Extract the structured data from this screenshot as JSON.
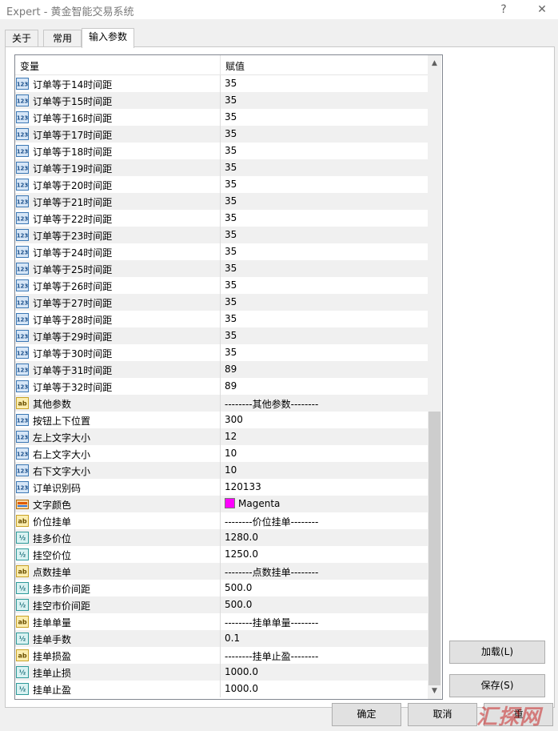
{
  "window": {
    "title": "Expert - 黄金智能交易系统",
    "help": "?",
    "close": "✕"
  },
  "tabs": [
    "关于",
    "常用",
    "输入参数"
  ],
  "table": {
    "headers": {
      "name": "变量",
      "value": "赋值"
    },
    "rows": [
      {
        "type": "int",
        "name": "订单等于14时间距",
        "value": "35"
      },
      {
        "type": "int",
        "name": "订单等于15时间距",
        "value": "35"
      },
      {
        "type": "int",
        "name": "订单等于16时间距",
        "value": "35"
      },
      {
        "type": "int",
        "name": "订单等于17时间距",
        "value": "35"
      },
      {
        "type": "int",
        "name": "订单等于18时间距",
        "value": "35"
      },
      {
        "type": "int",
        "name": "订单等于19时间距",
        "value": "35"
      },
      {
        "type": "int",
        "name": "订单等于20时间距",
        "value": "35"
      },
      {
        "type": "int",
        "name": "订单等于21时间距",
        "value": "35"
      },
      {
        "type": "int",
        "name": "订单等于22时间距",
        "value": "35"
      },
      {
        "type": "int",
        "name": "订单等于23时间距",
        "value": "35"
      },
      {
        "type": "int",
        "name": "订单等于24时间距",
        "value": "35"
      },
      {
        "type": "int",
        "name": "订单等于25时间距",
        "value": "35"
      },
      {
        "type": "int",
        "name": "订单等于26时间距",
        "value": "35"
      },
      {
        "type": "int",
        "name": "订单等于27时间距",
        "value": "35"
      },
      {
        "type": "int",
        "name": "订单等于28时间距",
        "value": "35"
      },
      {
        "type": "int",
        "name": "订单等于29时间距",
        "value": "35"
      },
      {
        "type": "int",
        "name": "订单等于30时间距",
        "value": "35"
      },
      {
        "type": "int",
        "name": "订单等于31时间距",
        "value": "89"
      },
      {
        "type": "int",
        "name": "订单等于32时间距",
        "value": "89"
      },
      {
        "type": "string",
        "name": "其他参数",
        "value": "--------其他参数--------"
      },
      {
        "type": "int",
        "name": "按钮上下位置",
        "value": "300"
      },
      {
        "type": "int",
        "name": "左上文字大小",
        "value": "12"
      },
      {
        "type": "int",
        "name": "右上文字大小",
        "value": "10"
      },
      {
        "type": "int",
        "name": "右下文字大小",
        "value": "10"
      },
      {
        "type": "int",
        "name": "订单识别码",
        "value": "120133"
      },
      {
        "type": "color",
        "name": "文字颜色",
        "value": "Magenta",
        "color": "#ff00ff"
      },
      {
        "type": "string",
        "name": "价位挂单",
        "value": "--------价位挂单--------"
      },
      {
        "type": "double",
        "name": "挂多价位",
        "value": "1280.0"
      },
      {
        "type": "double",
        "name": "挂空价位",
        "value": "1250.0"
      },
      {
        "type": "string",
        "name": "点数挂单",
        "value": "--------点数挂单--------"
      },
      {
        "type": "double",
        "name": "挂多市价间距",
        "value": "500.0"
      },
      {
        "type": "double",
        "name": "挂空市价间距",
        "value": "500.0"
      },
      {
        "type": "string",
        "name": "挂单单量",
        "value": "--------挂单单量--------"
      },
      {
        "type": "double",
        "name": "挂单手数",
        "value": "0.1"
      },
      {
        "type": "string",
        "name": "挂单损盈",
        "value": "--------挂单止盈--------"
      },
      {
        "type": "double",
        "name": "挂单止损",
        "value": "1000.0"
      },
      {
        "type": "double",
        "name": "挂单止盈",
        "value": "1000.0"
      }
    ]
  },
  "buttons": {
    "load": "加载(L)",
    "save": "保存(S)",
    "ok": "确定",
    "cancel": "取消",
    "reset": "重"
  },
  "watermark": "汇探网",
  "icons": {
    "int": "123-icon",
    "double": "v2-icon",
    "string": "ab-icon",
    "color": "color-icon",
    "scroll_up": "chevron-up-icon",
    "scroll_down": "chevron-down-icon"
  }
}
